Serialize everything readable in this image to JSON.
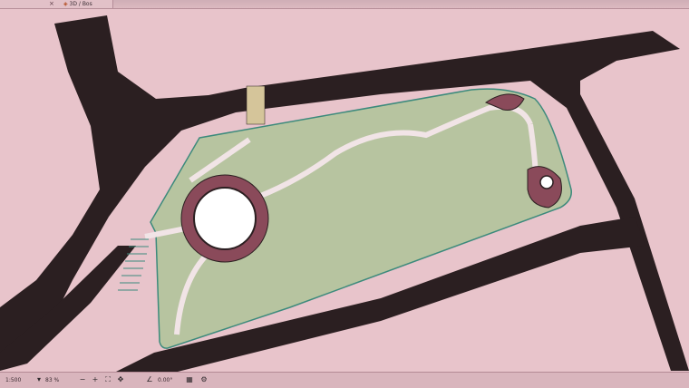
{
  "tabs": [
    {
      "label": ""
    },
    {
      "label": "3D / Bos"
    }
  ],
  "plan": {
    "colors": {
      "background": "#e8c4cb",
      "road": "#2b1f21",
      "lawn": "#b7c4a0",
      "path": "#f1e4e6",
      "planting": "#8a4a5a",
      "edge": "#3c8a7c"
    }
  },
  "status": {
    "scale": "1:500",
    "zoom": "83 %",
    "angle": "0.00°"
  },
  "icons": [
    "scale-icon",
    "zoom-out-icon",
    "zoom-in-icon",
    "fit-window-icon",
    "pan-icon",
    "angle-icon",
    "layer-icon",
    "settings-icon"
  ]
}
